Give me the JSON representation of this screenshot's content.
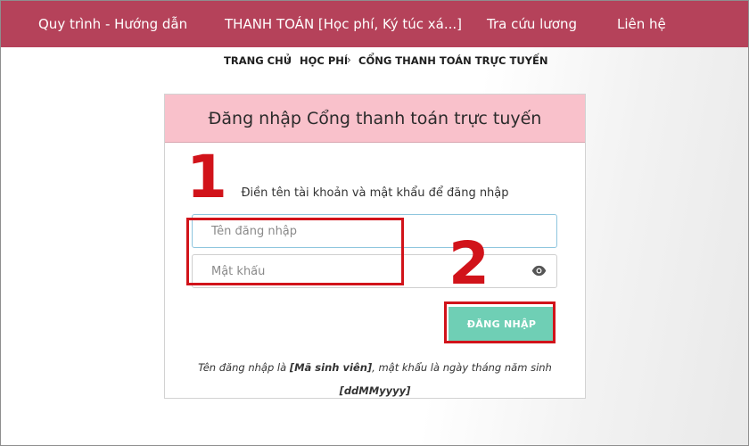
{
  "nav": {
    "items": [
      {
        "label": "Quy trình - Hướng dẫn"
      },
      {
        "label": "THANH TOÁN [Học phí, Ký túc xá...]"
      },
      {
        "label": "Tra cứu lương"
      },
      {
        "label": "Liên hệ"
      }
    ]
  },
  "breadcrumb": {
    "items": [
      "TRANG CHỦ",
      "HỌC PHÍ",
      "CỔNG THANH TOÁN TRỰC TUYẾN"
    ],
    "separator": "›"
  },
  "login": {
    "title": "Đăng nhập Cổng thanh toán trực tuyến",
    "instruction": "Điền tên tài khoản và mật khẩu để đăng nhập",
    "username": {
      "value": "",
      "placeholder": "Tên đăng nhập"
    },
    "password": {
      "value": "",
      "placeholder": "Mật khẩu"
    },
    "submit_label": "ĐĂNG NHẬP",
    "hint": {
      "prefix": "Tên đăng nhập là ",
      "emphasis": "[Mã sinh viên]",
      "suffix": ", mật khẩu là ngày tháng năm sinh",
      "format": "[ddMMyyyy]"
    }
  },
  "annotations": {
    "step1": "1",
    "step2": "2",
    "color": "#d1131a"
  },
  "colors": {
    "nav_bg": "#b5425a",
    "header_bg": "#f9c1cb",
    "button_bg": "#6fcfb5"
  },
  "icons": {
    "password_toggle": "eye-icon"
  }
}
